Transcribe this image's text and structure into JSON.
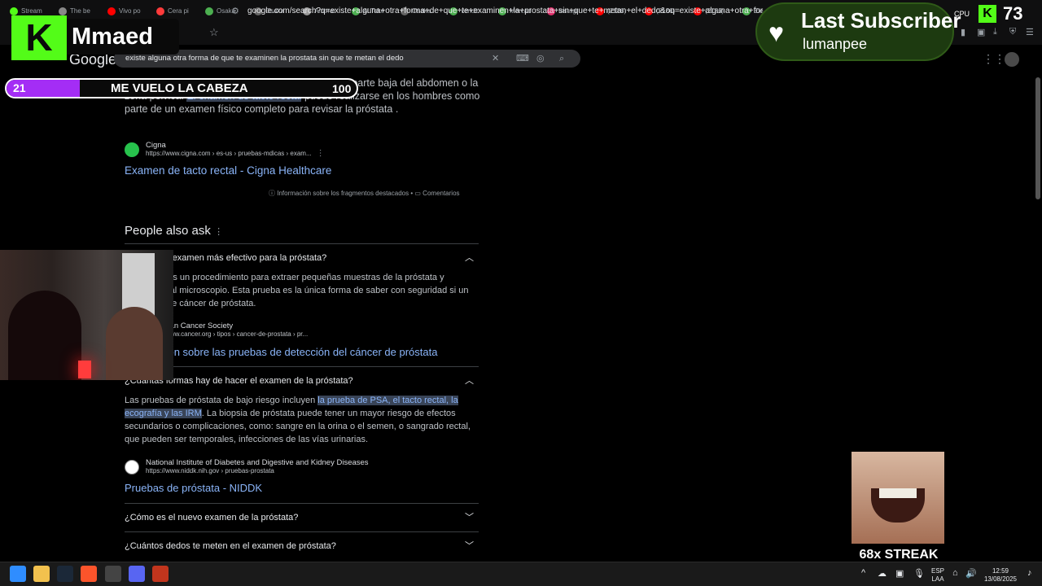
{
  "browser": {
    "tabs": [
      "Stream",
      "The be",
      "Vivo po",
      "Cera pi",
      "Osaka",
      "Osaka",
      "Amorar",
      "Al Toke",
      "Osaka",
      "veridic",
      "Mercad",
      "Instagr",
      "(2186)",
      "(2186)",
      "(2186)",
      "Ele"
    ],
    "url": "google.com/search?q=existe+alguna+otra+forma+de+que+te+examinen+la+prostata+sin+que+te+metan+el+dedo&oq=existe+alguna+otra+for...",
    "search_query": "existe alguna otra forma de que te examinen la prostata sin que te metan el dedo",
    "google_logo": "Google"
  },
  "snippet": {
    "text_1": "Es posible que use la otra mano para presionar la parte baja del abdomen o la zona pélvica. ",
    "highlight": "El examen de tacto rectal",
    "text_2": " puede realizarse en los hombres como parte de un examen físico completo para revisar la próstata .",
    "source_name": "Cigna",
    "source_url": "https://www.cigna.com › es-us › pruebas-mdicas › exam...",
    "link": "Examen de tacto rectal - Cigna Healthcare",
    "info": "Información sobre los fragmentos destacados",
    "comments": "Comentarios"
  },
  "paa": {
    "title": "People also ask",
    "q1": "¿Cuál es el examen más efectivo para la próstata?",
    "a1": "La biopsia es un procedimiento para extraer pequeñas muestras de la próstata y analizarlas al microscopio. Esta prueba es la única forma de saber con seguridad si un hombre tiene cáncer de próstata.",
    "s1_name": "American Cancer Society",
    "s1_url": "https://www.cancer.org › tipos › cancer-de-prostata › pr...",
    "l1": "Información sobre las pruebas de detección del cáncer de próstata",
    "q2": "¿Cuántas formas hay de hacer el examen de la próstata?",
    "a2_pre": "Las pruebas de próstata de bajo riesgo incluyen ",
    "a2_hl": "la prueba de PSA, el tacto rectal, la ecografía y las IRM",
    "a2_post": ". La biopsia de próstata puede tener un mayor riesgo de efectos secundarios o complicaciones, como: sangre en la orina o el semen, o sangrado rectal, que pueden ser temporales, infecciones de las vías urinarias.",
    "s2_name": "National Institute of Diabetes and Digestive and Kidney Diseases",
    "s2_url": "https://www.niddk.nih.gov › pruebas-prostata",
    "l2": "Pruebas de próstata - NIDDK",
    "q3": "¿Cómo es el nuevo examen de la próstata?",
    "q4": "¿Cuántos dedos te meten en el examen de próstata?"
  },
  "overlay": {
    "channel": "Mmaed",
    "goal_current": "21",
    "goal_title": "ME VUELO LA CABEZA",
    "goal_max": "100",
    "goal_progress": 0.21,
    "last_sub_title": "Last Subscriber",
    "last_sub_user": "lumanpee",
    "cpu_label": "CPU",
    "viewer_count": "73",
    "streak": "68x STREAK"
  },
  "taskbar": {
    "lang_1": "ESP",
    "lang_2": "LAA",
    "time": "12:59",
    "date": "13/08/2025"
  },
  "colors": {
    "kick_green": "#53fc18",
    "goal_purple": "#a42df5",
    "link_blue": "#8ab4f8"
  }
}
